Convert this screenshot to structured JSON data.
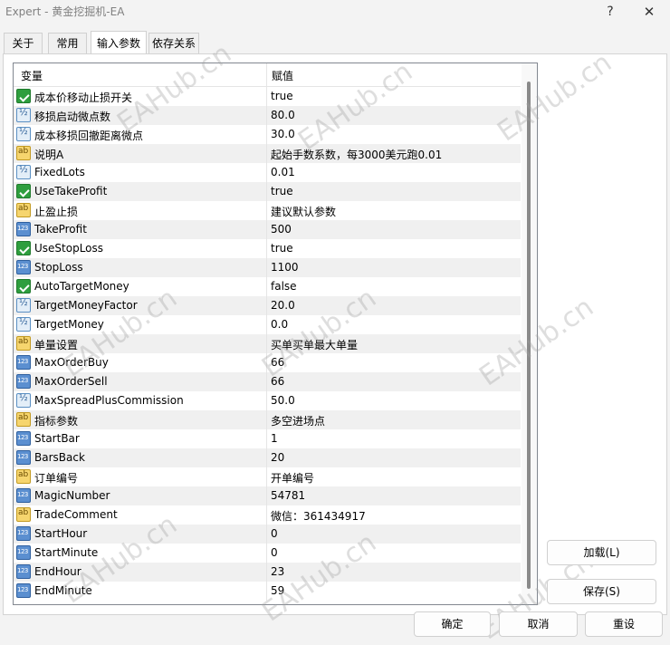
{
  "window": {
    "title": "Expert - 黄金挖掘机-EA",
    "help_glyph": "?",
    "close_glyph": "✕"
  },
  "tabs": [
    {
      "label": "关于",
      "active": false
    },
    {
      "label": "常用",
      "active": false
    },
    {
      "label": "输入参数",
      "active": true
    },
    {
      "label": "依存关系",
      "active": false
    }
  ],
  "grid": {
    "header_variable": "变量",
    "header_value": "赋值",
    "rows": [
      {
        "type": "bool-icon",
        "name": "成本价移动止损开关",
        "value": "true"
      },
      {
        "type": "double-icon",
        "name": "移损启动微点数",
        "value": "80.0"
      },
      {
        "type": "double-icon",
        "name": "成本移损回撤距离微点",
        "value": "30.0"
      },
      {
        "type": "string-icon",
        "name": "说明A",
        "value": "起始手数系数，每3000美元跑0.01"
      },
      {
        "type": "double-icon",
        "name": "FixedLots",
        "value": "0.01"
      },
      {
        "type": "bool-icon",
        "name": "UseTakeProfit",
        "value": "true"
      },
      {
        "type": "string-icon",
        "name": "止盈止损",
        "value": "建议默认参数"
      },
      {
        "type": "int-icon",
        "name": "TakeProfit",
        "value": "500"
      },
      {
        "type": "bool-icon",
        "name": "UseStopLoss",
        "value": "true"
      },
      {
        "type": "int-icon",
        "name": "StopLoss",
        "value": "1100"
      },
      {
        "type": "bool-icon",
        "name": "AutoTargetMoney",
        "value": "false"
      },
      {
        "type": "double-icon",
        "name": "TargetMoneyFactor",
        "value": "20.0"
      },
      {
        "type": "double-icon",
        "name": "TargetMoney",
        "value": "0.0"
      },
      {
        "type": "string-icon",
        "name": "单量设置",
        "value": "买单买单最大单量"
      },
      {
        "type": "int-icon",
        "name": "MaxOrderBuy",
        "value": "66"
      },
      {
        "type": "int-icon",
        "name": "MaxOrderSell",
        "value": "66"
      },
      {
        "type": "double-icon",
        "name": "MaxSpreadPlusCommission",
        "value": "50.0"
      },
      {
        "type": "string-icon",
        "name": "指标参数",
        "value": "多空进场点"
      },
      {
        "type": "int-icon",
        "name": "StartBar",
        "value": "1"
      },
      {
        "type": "int-icon",
        "name": "BarsBack",
        "value": "20"
      },
      {
        "type": "string-icon",
        "name": "订单编号",
        "value": "开单编号"
      },
      {
        "type": "int-icon",
        "name": "MagicNumber",
        "value": "54781"
      },
      {
        "type": "string-icon",
        "name": "TradeComment",
        "value": "微信：361434917"
      },
      {
        "type": "int-icon",
        "name": "StartHour",
        "value": "0"
      },
      {
        "type": "int-icon",
        "name": "StartMinute",
        "value": "0"
      },
      {
        "type": "int-icon",
        "name": "EndHour",
        "value": "23"
      },
      {
        "type": "int-icon",
        "name": "EndMinute",
        "value": "59"
      }
    ]
  },
  "buttons": {
    "load": "加载(L)",
    "save": "保存(S)",
    "ok": "确定",
    "cancel": "取消",
    "reset": "重设"
  },
  "watermark_text": "EAHub.cn"
}
